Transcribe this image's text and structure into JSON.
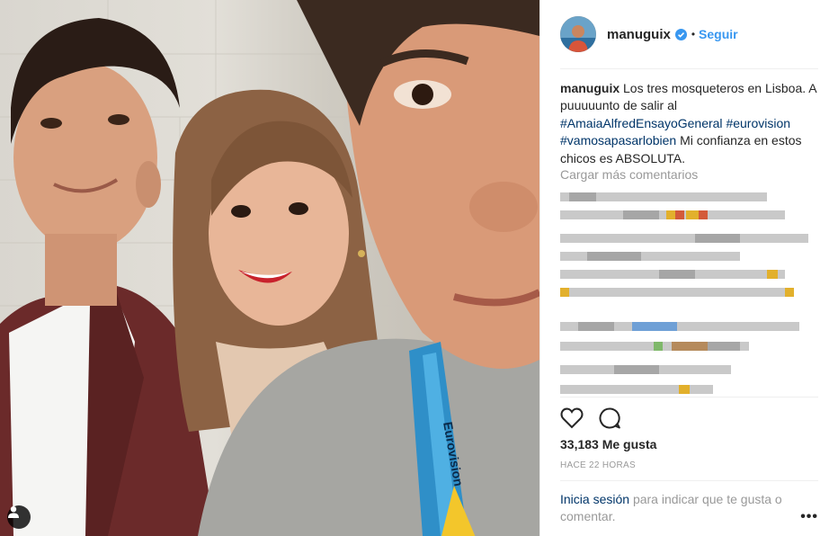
{
  "post": {
    "username": "manuguix",
    "follow_label": "Seguir",
    "separator": "•",
    "caption": {
      "username": "manuguix",
      "text_1": "Los tres mosqueteros en Lisboa. A puuuuunto de salir al",
      "hashtag_1": "#AmaiaAlfredEnsayoGeneral",
      "hashtag_2": "#eurovision",
      "hashtag_3": "#vamosapasarlobien",
      "text_2": "Mi confianza en estos chicos es ABSOLUTA."
    },
    "load_more_label": "Cargar más comentarios",
    "likes": "33,183 Me gusta",
    "timestamp": "HACE 22 HORAS",
    "login_prompt": {
      "link_label": "Inicia sesión",
      "text": "para indicar que te gusta o comentar."
    },
    "more_options": "•••",
    "lanyard_text": "Eurovision"
  },
  "icons": {
    "verified": "verified-badge-icon",
    "like": "heart-icon",
    "comment": "comment-bubble-icon",
    "tag": "user-tag-icon",
    "more": "more-options-icon"
  },
  "colors": {
    "link_blue": "#3897f0",
    "hashtag_blue": "#003569",
    "muted": "#999999",
    "text": "#262626",
    "border": "#efefef"
  }
}
